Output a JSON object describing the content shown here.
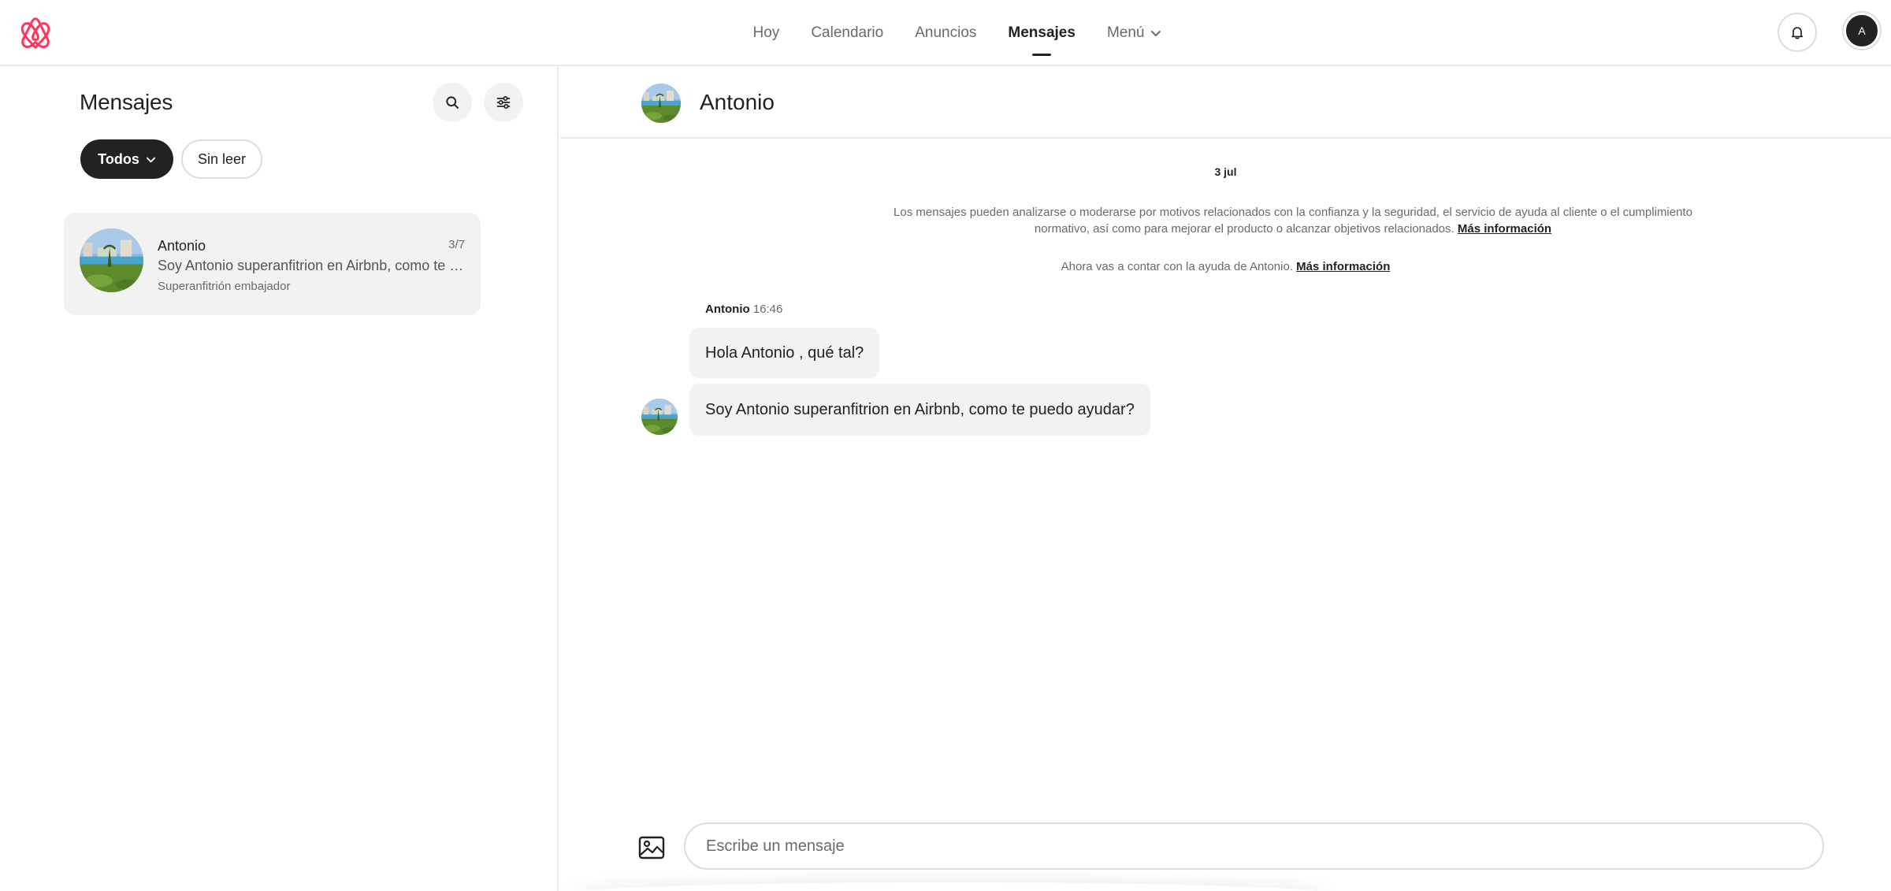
{
  "header": {
    "logo_icon": "airbnb-logo-icon",
    "nav": [
      {
        "label": "Hoy"
      },
      {
        "label": "Calendario"
      },
      {
        "label": "Anuncios"
      },
      {
        "label": "Mensajes",
        "active": true
      },
      {
        "label": "Menú"
      }
    ],
    "bell_icon": "bell-icon",
    "avatar_initial": "A"
  },
  "sidebar": {
    "title": "Mensajes",
    "search_icon": "search-icon",
    "filter_icon": "sliders-icon",
    "filters": {
      "all_label": "Todos",
      "unread_label": "Sin leer"
    },
    "conversations": [
      {
        "name": "Antonio",
        "date": "3/7",
        "preview": "Soy Antonio superanfitrion en Airbnb, como te puedo ayudar?",
        "subtitle": "Superanfitrión embajador"
      }
    ]
  },
  "chat": {
    "contact_name": "Antonio",
    "date_separator": "3 jul",
    "notice_text": "Los mensajes pueden analizarse o moderarse por motivos relacionados con la confianza y la seguridad, el servicio de ayuda al cliente o el cumplimiento normativo, así como para mejorar el producto o alcanzar objetivos relacionados.",
    "notice_link": "Más información",
    "assist_text": "Ahora vas a contar con la ayuda de Antonio.",
    "assist_link": "Más información",
    "messages": [
      {
        "sender": "Antonio",
        "time": "16:46",
        "text": "Hola Antonio , qué tal?"
      },
      {
        "sender": "Antonio",
        "time": "",
        "text": "Soy Antonio superanfitrion en Airbnb, como te puedo ayudar?"
      }
    ],
    "composer_placeholder": "Escribe un mensaje",
    "image_icon": "image-icon"
  },
  "colors": {
    "brand": "#FF385C",
    "text_primary": "#222222",
    "text_secondary": "#6A6A6A",
    "bubble_bg": "#F2F2F2",
    "border": "#DDDDDD"
  }
}
